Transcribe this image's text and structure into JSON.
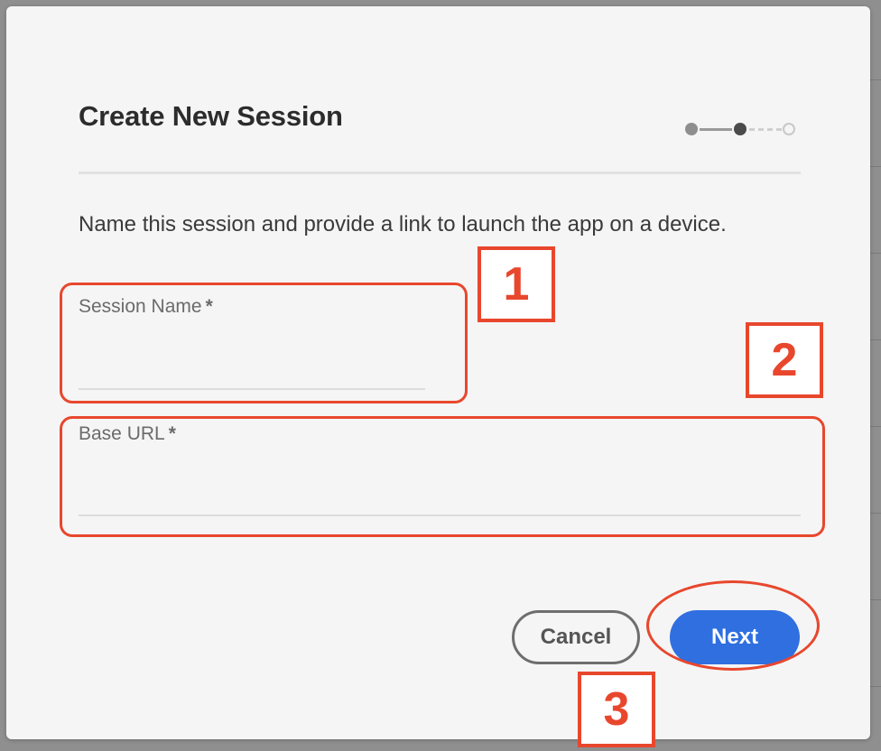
{
  "dialog": {
    "title": "Create New Session",
    "description": "Name this session and provide a link to launch the app on a device.",
    "stepper": {
      "total_steps": 3,
      "current_step": 2
    }
  },
  "fields": {
    "session_name": {
      "label": "Session Name",
      "required_marker": "*",
      "value": ""
    },
    "base_url": {
      "label": "Base URL",
      "required_marker": "*",
      "value": ""
    }
  },
  "buttons": {
    "cancel_label": "Cancel",
    "next_label": "Next"
  },
  "annotations": {
    "badge_1": "1",
    "badge_2": "2",
    "badge_3": "3"
  },
  "colors": {
    "primary": "#2f6fe0",
    "annotation": "#e8472d",
    "dialog_background": "#f5f5f5",
    "backdrop": "#8f8f8f"
  }
}
